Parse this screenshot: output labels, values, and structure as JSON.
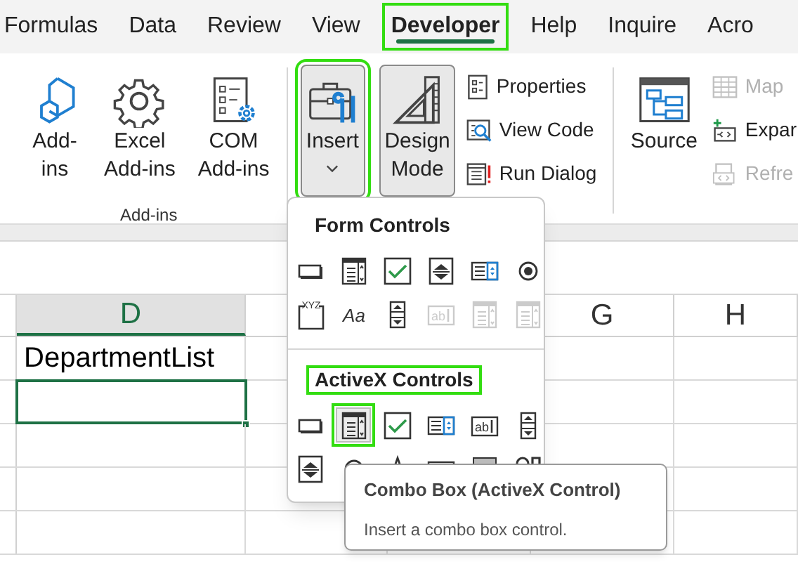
{
  "tabs": [
    {
      "label": "Formulas",
      "selected": false
    },
    {
      "label": "Data",
      "selected": false
    },
    {
      "label": "Review",
      "selected": false
    },
    {
      "label": "View",
      "selected": false
    },
    {
      "label": "Developer",
      "selected": true,
      "highlighted": true
    },
    {
      "label": "Help",
      "selected": false
    },
    {
      "label": "Inquire",
      "selected": false
    },
    {
      "label": "Acro",
      "selected": false
    }
  ],
  "ribbon": {
    "groups": [
      {
        "label": "Add-ins",
        "large": [
          {
            "kind": "addins",
            "lines": [
              "Add-",
              "ins"
            ],
            "pressed": false
          },
          {
            "kind": "excel-addins",
            "lines": [
              "Excel",
              "Add-ins"
            ],
            "pressed": false
          },
          {
            "kind": "com-addins",
            "lines": [
              "COM",
              "Add-ins"
            ],
            "pressed": false
          }
        ]
      },
      {
        "large": [
          {
            "kind": "insert",
            "lines": [
              "Insert"
            ],
            "dropdown": true,
            "pressed": true,
            "highlighted": true
          },
          {
            "kind": "design-mode",
            "lines": [
              "Design",
              "Mode"
            ],
            "pressed": true
          }
        ],
        "small": [
          {
            "kind": "properties",
            "label": "Properties",
            "disabled": false
          },
          {
            "kind": "view-code",
            "label": "View Code",
            "disabled": false
          },
          {
            "kind": "run-dialog",
            "label": "Run Dialog",
            "disabled": false
          }
        ]
      },
      {
        "large": [
          {
            "kind": "source",
            "lines": [
              "Source"
            ],
            "pressed": false
          }
        ],
        "small": [
          {
            "kind": "map",
            "label": "Map",
            "disabled": true
          },
          {
            "kind": "expand",
            "label": "Expar",
            "disabled": false
          },
          {
            "kind": "refresh",
            "label": "Refre",
            "disabled": true
          }
        ]
      }
    ]
  },
  "sheet": {
    "columns": [
      {
        "label": "D",
        "selected": true
      },
      {
        "label": "G",
        "selected": false
      },
      {
        "label": "H",
        "selected": false
      }
    ],
    "rows": [
      {
        "cells": [
          {
            "text": "DepartmentList",
            "selected": false
          }
        ]
      },
      {
        "cells": [
          {
            "selected": true
          }
        ]
      },
      {
        "cells": [
          {
            "selected": false
          }
        ]
      },
      {
        "cells": [
          {
            "selected": false
          }
        ]
      },
      {
        "cells": [
          {
            "selected": false
          }
        ]
      }
    ]
  },
  "insert_menu": {
    "sections": [
      {
        "title": "Form Controls",
        "controls": [
          {
            "kind": "button",
            "disabled": false
          },
          {
            "kind": "combo",
            "disabled": false
          },
          {
            "kind": "checkbox",
            "disabled": false
          },
          {
            "kind": "spin",
            "disabled": false
          },
          {
            "kind": "listbox",
            "disabled": false
          },
          {
            "kind": "radio",
            "disabled": false
          },
          {
            "kind": "groupbox",
            "glyph": "XYZ",
            "disabled": false
          },
          {
            "kind": "label",
            "glyph": "Aa",
            "disabled": false
          },
          {
            "kind": "scrollbar",
            "disabled": false
          },
          {
            "kind": "textfield",
            "glyph": "ab",
            "disabled": true
          },
          {
            "kind": "combo",
            "disabled": true
          },
          {
            "kind": "combo",
            "disabled": true
          }
        ]
      },
      {
        "title": "ActiveX Controls",
        "highlighted": true,
        "controls": [
          {
            "kind": "button",
            "disabled": false
          },
          {
            "kind": "combo",
            "disabled": false,
            "highlighted": true
          },
          {
            "kind": "checkbox",
            "disabled": false
          },
          {
            "kind": "listbox",
            "disabled": false
          },
          {
            "kind": "textfield",
            "glyph": "ab",
            "disabled": false
          },
          {
            "kind": "scrollbar",
            "disabled": false
          },
          {
            "kind": "spin",
            "disabled": false
          },
          {
            "kind": "radio",
            "disabled": false
          },
          {
            "kind": "label",
            "disabled": false
          },
          {
            "kind": "image",
            "disabled": false
          },
          {
            "kind": "toggle",
            "disabled": false
          },
          {
            "kind": "more",
            "disabled": false
          }
        ]
      }
    ]
  },
  "tooltip": {
    "title": "Combo Box (ActiveX Control)",
    "description": "Insert a combo box control."
  }
}
